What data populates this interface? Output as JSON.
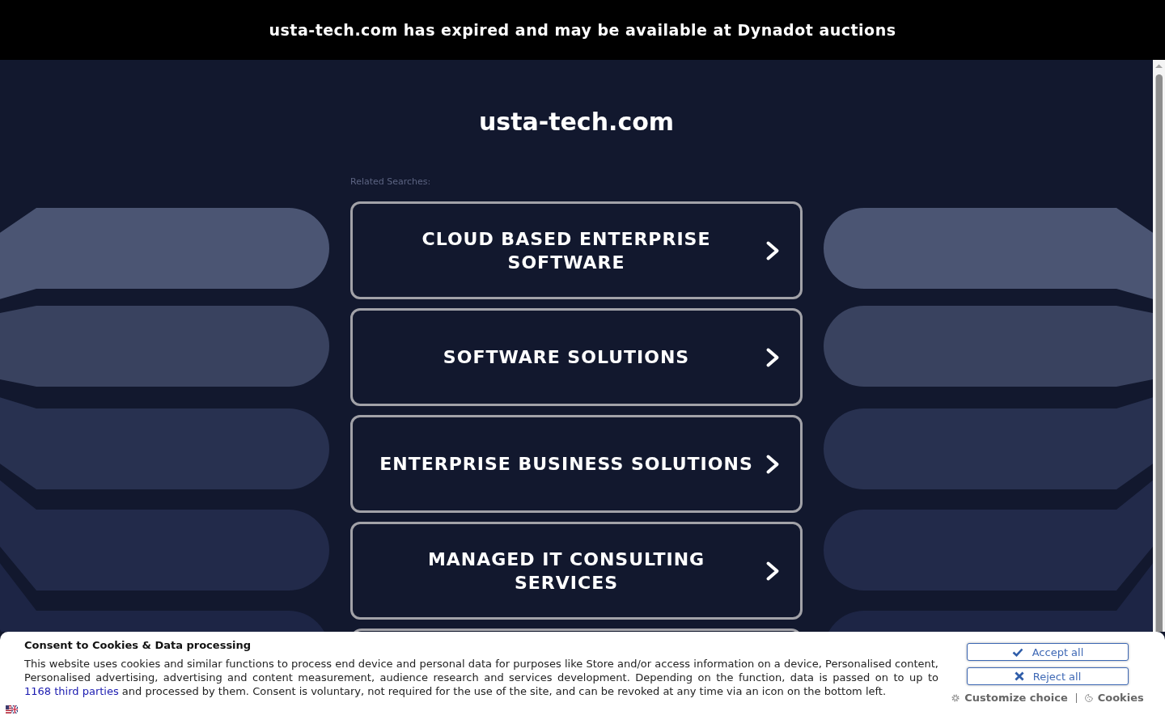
{
  "banner": {
    "text": "usta-tech.com has expired and may be available at Dynadot auctions"
  },
  "site_title": "usta-tech.com",
  "related_searches": {
    "heading": "Related Searches:",
    "links": [
      "CLOUD BASED ENTERPRISE SOFTWARE",
      "SOFTWARE SOLUTIONS",
      "ENTERPRISE BUSINESS SOLUTIONS",
      "MANAGED IT CONSULTING SERVICES"
    ]
  },
  "consent": {
    "title": "Consent to Cookies & Data processing",
    "text": "This website uses cookies and similar functions to process end device and personal data for purposes like Store and/or access information on a device, Personalised content, Personalised advertising, advertising and content measurement, audience research and services development. Depending on the function, data is passed on to up to",
    "link": "1168 third parties",
    "text_after": "and processed by them. Consent is voluntary, not required for the use of the site, and can be revoked at any time via an icon on the bottom left.",
    "buttons": [
      {
        "kind": "accept",
        "label": "Accept all"
      },
      {
        "kind": "reject",
        "label": "Reject all"
      }
    ],
    "links": [
      {
        "kind": "customize",
        "label": "Customize choice"
      },
      {
        "kind": "cookies",
        "label": "Cookies"
      }
    ]
  }
}
